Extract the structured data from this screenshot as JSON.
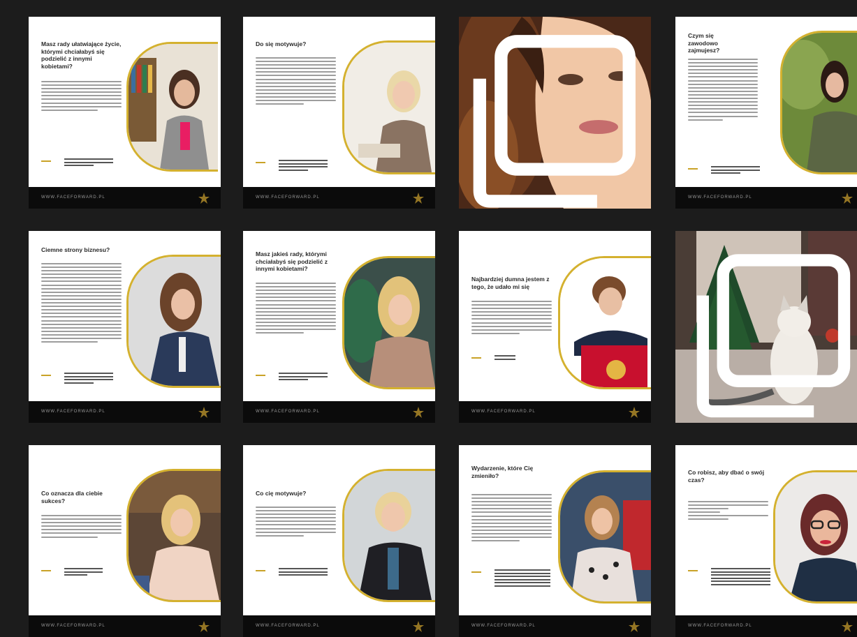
{
  "colors": {
    "background": "#1c1c1c",
    "card": "#ffffff",
    "footer": "#0b0b0b",
    "accent_gold": "#d4b12f"
  },
  "grid": {
    "tiles": [
      {
        "kind": "card",
        "title": "Masz rady ułatwiające życie, którymi chciałabyś się podzielić z innymi kobietami?",
        "footer": "WWW.FACEFORWARD.PL",
        "icon": "star-logo-icon"
      },
      {
        "kind": "card",
        "title": "Do się motywuje?",
        "footer": "WWW.FACEFORWARD.PL",
        "icon": "star-logo-icon"
      },
      {
        "kind": "photo",
        "subject": "woman-with-curly-hair-closeup",
        "icon": "multiple-images-icon"
      },
      {
        "kind": "card",
        "title": "Czym się zawodowo zajmujesz?",
        "footer": "WWW.FACEFORWARD.PL",
        "icon": "star-logo-icon"
      },
      {
        "kind": "card",
        "title": "Ciemne strony biznesu?",
        "footer": "WWW.FACEFORWARD.PL",
        "icon": "star-logo-icon"
      },
      {
        "kind": "card",
        "title": "Masz jakieś rady, którymi chciałabyś się podzielić z innymi kobietami?",
        "footer": "WWW.FACEFORWARD.PL",
        "icon": "star-logo-icon"
      },
      {
        "kind": "card",
        "title": "Najbardziej dumna jestem z tego, że udało mi się",
        "footer": "WWW.FACEFORWARD.PL",
        "icon": "star-logo-icon"
      },
      {
        "kind": "photo",
        "subject": "white-cat-on-table-with-christmas-tree",
        "icon": "multiple-images-icon"
      },
      {
        "kind": "card",
        "title": "Co oznacza dla ciebie sukces?",
        "footer": "WWW.FACEFORWARD.PL",
        "icon": "star-logo-icon"
      },
      {
        "kind": "card",
        "title": "Co cię motywuje?",
        "footer": "WWW.FACEFORWARD.PL",
        "icon": "star-logo-icon"
      },
      {
        "kind": "card",
        "title": "Wydarzenie, które Cię zmieniło?",
        "footer": "WWW.FACEFORWARD.PL",
        "icon": "star-logo-icon"
      },
      {
        "kind": "card",
        "title": "Co robisz, aby dbać o swój czas?",
        "footer": "WWW.FACEFORWARD.PL",
        "icon": "star-logo-icon"
      }
    ]
  }
}
